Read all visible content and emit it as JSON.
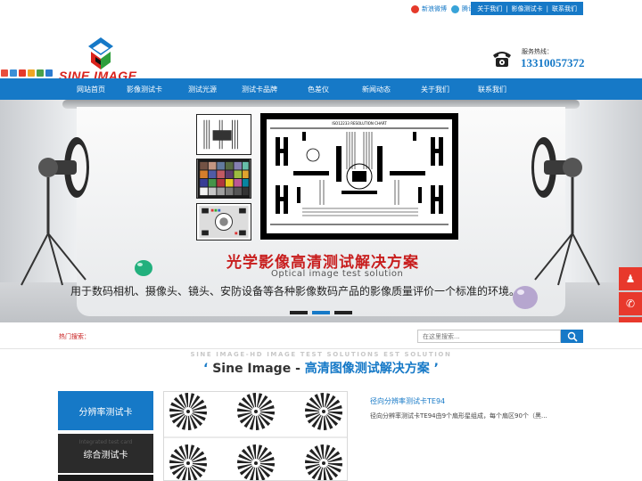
{
  "topbar": {
    "weibo_sina": "新浪微博",
    "weibo_tencent": "腾讯微博",
    "links": [
      "关于我们",
      "|",
      "影像测试卡",
      "|",
      "联系我们"
    ]
  },
  "header": {
    "logo_text": "SINE IMAGE",
    "hotline_label": "服务热线：",
    "hotline_number": "13310057372"
  },
  "nav": {
    "items": [
      "网站首页",
      "影像测试卡",
      "测试光源",
      "测试卡品牌",
      "色差仪",
      "新闻动态",
      "关于我们",
      "联系我们"
    ]
  },
  "banner": {
    "slogan_cn": "光学影像高清测试解决方案",
    "slogan_en": "Optical image test solution",
    "slogan_desc": "用于数码相机、摄像头、镜头、安防设备等各种影像数码产品的影像质量评价一个标准的环境。",
    "chart_header": "ISO12233 RESOLUTION CHART"
  },
  "search": {
    "hot_label": "热门搜索：",
    "placeholder": "在这里搜索..."
  },
  "section": {
    "subtitle": "SINE IMAGE-HD IMAGE TEST SOLUTIONS EST SOLUTION",
    "quote_open": "‘",
    "title_brand": "Sine Image -",
    "title_cn": "高清图像测试解决方案",
    "quote_close": "’"
  },
  "categories": {
    "items": [
      {
        "label": "分辨率测试卡",
        "bg": "#1679c7"
      },
      {
        "label": "综合测试卡",
        "bg": "#2b2b2b"
      },
      {
        "label": "",
        "bg": "#1a1a1a"
      }
    ],
    "ghost_label": "Integrated test card"
  },
  "product": {
    "title": "径向分辨率测试卡TE94",
    "desc": "径向分辨率测试卡TE94由9个扇形星组成，每个扇区90个（黑..."
  },
  "colors": {
    "brand_blue": "#1679c7",
    "accent_red": "#c81e1e"
  }
}
